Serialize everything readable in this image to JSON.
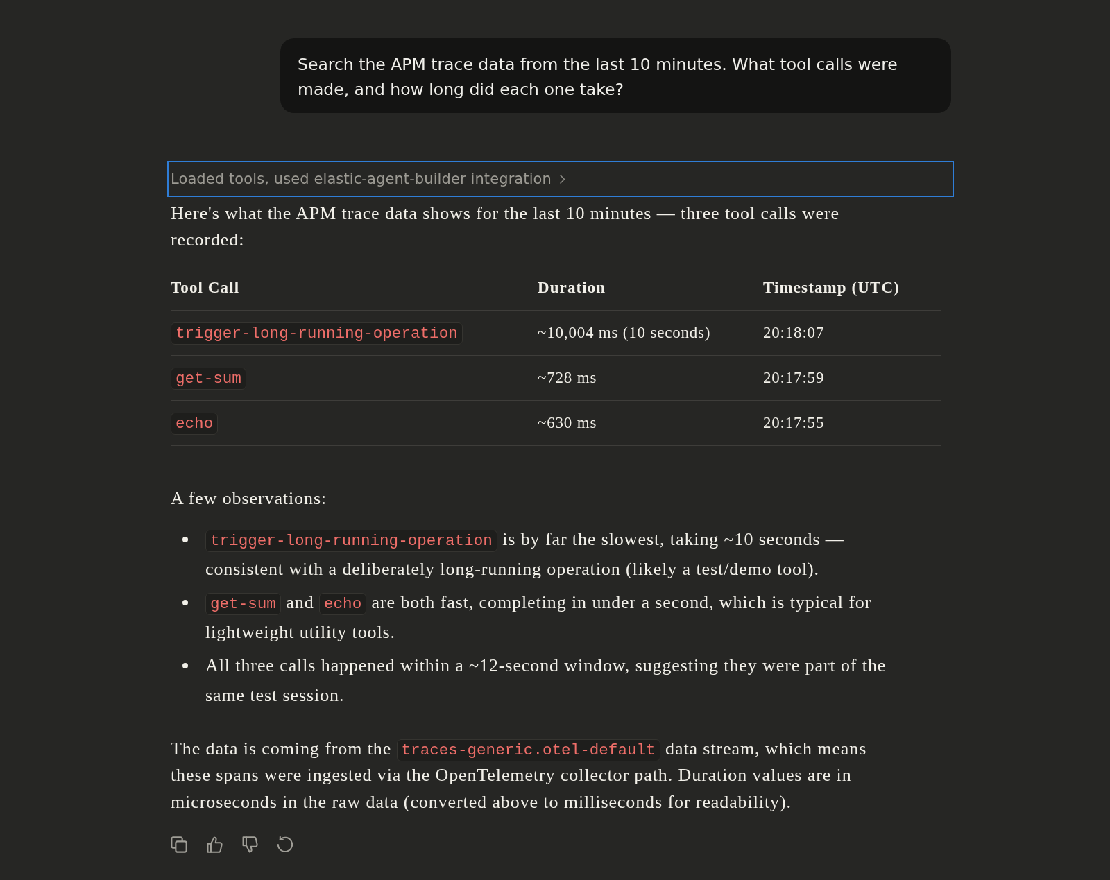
{
  "user_message": {
    "text": "Search the APM trace data from the last 10 minutes. What tool calls were made, and how long did each one take?"
  },
  "tool_summary": {
    "label": "Loaded tools, used elastic-agent-builder integration",
    "focused": true
  },
  "intro": "Here's what the APM trace data shows for the last 10 minutes — three tool calls were recorded:",
  "table": {
    "columns": [
      "Tool Call",
      "Duration",
      "Timestamp (UTC)"
    ],
    "rows": [
      {
        "tool": "trigger-long-running-operation",
        "duration": "~10,004 ms (10 seconds)",
        "timestamp": "20:18:07"
      },
      {
        "tool": "get-sum",
        "duration": "~728 ms",
        "timestamp": "20:17:59"
      },
      {
        "tool": "echo",
        "duration": "~630 ms",
        "timestamp": "20:17:55"
      }
    ]
  },
  "observations_heading": "A few observations:",
  "observations": [
    {
      "segments": [
        {
          "kind": "code",
          "text": "trigger-long-running-operation"
        },
        {
          "kind": "text",
          "text": " is by far the slowest, taking ~10 seconds — consistent with a deliberately long-running operation (likely a test/demo tool)."
        }
      ]
    },
    {
      "segments": [
        {
          "kind": "code",
          "text": "get-sum"
        },
        {
          "kind": "text",
          "text": " and "
        },
        {
          "kind": "code",
          "text": "echo"
        },
        {
          "kind": "text",
          "text": " are both fast, completing in under a second, which is typical for lightweight utility tools."
        }
      ]
    },
    {
      "segments": [
        {
          "kind": "text",
          "text": "All three calls happened within a ~12-second window, suggesting they were part of the same test session."
        }
      ]
    }
  ],
  "closing": {
    "segments": [
      {
        "kind": "text",
        "text": "The data is coming from the "
      },
      {
        "kind": "code",
        "text": "traces-generic.otel-default"
      },
      {
        "kind": "text",
        "text": " data stream, which means these spans were ingested via the OpenTelemetry collector path. Duration values are in microseconds in the raw data (converted above to milliseconds for readability)."
      }
    ]
  },
  "actions": [
    {
      "kind": "copy"
    },
    {
      "kind": "thumbs_up"
    },
    {
      "kind": "thumbs_down"
    },
    {
      "kind": "retry"
    }
  ]
}
